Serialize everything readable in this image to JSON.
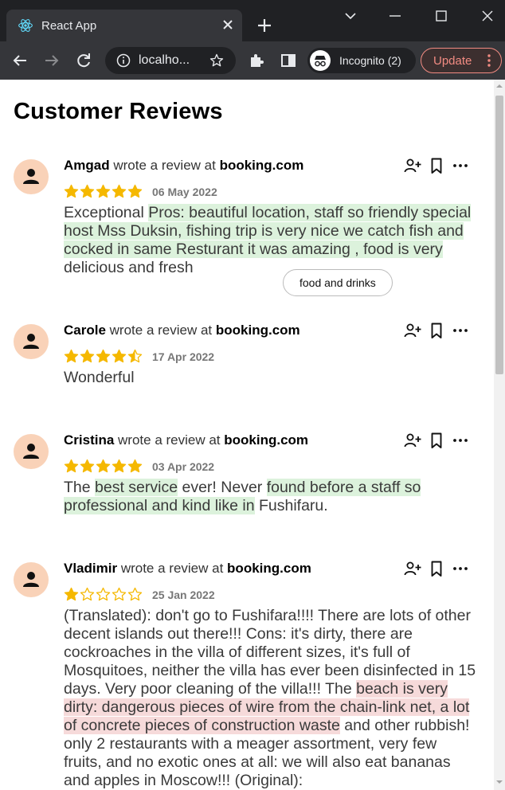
{
  "browser": {
    "tab_title": "React App",
    "url": "localho...",
    "incognito_label": "Incognito (2)",
    "update_label": "Update"
  },
  "page": {
    "title": "Customer Reviews"
  },
  "reviews": [
    {
      "author": "Amgad",
      "connector": " wrote a review at ",
      "source": "booking.com",
      "rating": 5,
      "date": "06 May 2022",
      "segments": [
        {
          "text": "Exceptional ",
          "sentiment": "none"
        },
        {
          "text": "Pros: beautiful location, staff so friendly special host Mss Duksin, fishing trip is very nice we catch fish and cocked in same Resturant it was amazing , food is very",
          "sentiment": "positive"
        },
        {
          "text": " delicious and fresh",
          "sentiment": "none"
        }
      ],
      "topic": "food and drinks"
    },
    {
      "author": "Carole",
      "connector": " wrote a review at ",
      "source": "booking.com",
      "rating": 4.5,
      "date": "17 Apr 2022",
      "segments": [
        {
          "text": "Wonderful",
          "sentiment": "none"
        }
      ]
    },
    {
      "author": "Cristina",
      "connector": " wrote a review at ",
      "source": "booking.com",
      "rating": 5,
      "date": "03 Apr 2022",
      "segments": [
        {
          "text": "The ",
          "sentiment": "none"
        },
        {
          "text": "best service",
          "sentiment": "positive"
        },
        {
          "text": " ever! Never ",
          "sentiment": "none"
        },
        {
          "text": "found before a staff so professional and kind like in",
          "sentiment": "positive"
        },
        {
          "text": " Fushifaru.",
          "sentiment": "none"
        }
      ]
    },
    {
      "author": "Vladimir",
      "connector": " wrote a review at ",
      "source": "booking.com",
      "rating": 1,
      "date": "25 Jan 2022",
      "segments": [
        {
          "text": "(Translated): don't go to Fushifara!!!! There are lots of other decent islands out there!!! Cons: it's dirty, there are cockroaches in the villa of different sizes, it's full of Mosquitoes, neither the villa has ever been disinfected in 15 days. Very poor cleaning of the villa!!! The ",
          "sentiment": "none"
        },
        {
          "text": "beach is very dirty: dangerous pieces of wire from the chain-link net, a lot of concrete pieces of construction waste",
          "sentiment": "negative"
        },
        {
          "text": " and other rubbish! only 2 restaurants with a meager assortment, very few fruits, and no exotic ones at all: we will also eat bananas and apples in Moscow!!! (Original):",
          "sentiment": "none"
        }
      ]
    }
  ],
  "colors": {
    "star": "#f5b800",
    "avatar_bg": "#f9d2b8",
    "positive_highlight": "#dcf2dc",
    "negative_highlight": "#f6dada",
    "chrome_dark": "#202124",
    "chrome_toolbar": "#35363a",
    "update_accent": "#f28b82"
  },
  "icons": {
    "tab_favicon": "react-logo-icon",
    "avatar": "user-icon",
    "follow": "person-add-icon",
    "bookmark": "bookmark-icon",
    "more": "more-horizontal-icon"
  }
}
